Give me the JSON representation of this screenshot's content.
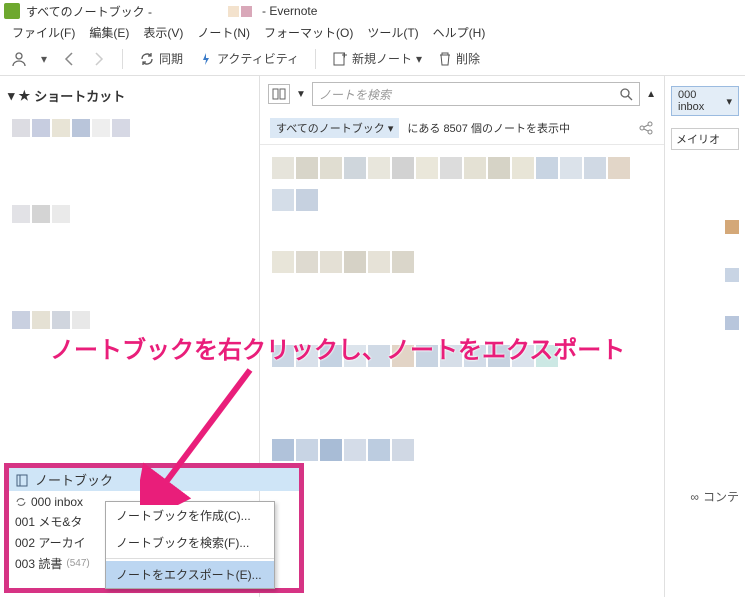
{
  "window": {
    "title": "すべてのノートブック -",
    "app_name": "- Evernote"
  },
  "menu": {
    "file": "ファイル(F)",
    "edit": "編集(E)",
    "view": "表示(V)",
    "note": "ノート(N)",
    "format": "フォーマット(O)",
    "tool": "ツール(T)",
    "help": "ヘルプ(H)"
  },
  "toolbar": {
    "sync": "同期",
    "activity": "アクティビティ",
    "new_note": "新規ノート",
    "delete": "削除"
  },
  "sidebar": {
    "shortcuts_label": "ショートカット",
    "notebooks_label": "ノートブック",
    "items": [
      {
        "name": "000 inbox",
        "count": ""
      },
      {
        "name": "001 メモ&タ",
        "count": ""
      },
      {
        "name": "002 アーカイ",
        "count": ""
      },
      {
        "name": "003 読書",
        "count": "(547)"
      }
    ]
  },
  "search": {
    "placeholder": "ノートを検索"
  },
  "filter": {
    "chip": "すべてのノートブック",
    "status_prefix": "にある",
    "count": "8507",
    "status_suffix": "個のノートを表示中"
  },
  "rightpane": {
    "inbox": "000 inbox",
    "font": "メイリオ",
    "content": "コンテ"
  },
  "context_menu": {
    "create": "ノートブックを作成(C)...",
    "search": "ノートブックを検索(F)...",
    "export": "ノートをエクスポート(E)..."
  },
  "annotation": "ノートブックを右クリックし、ノートをエクスポート"
}
